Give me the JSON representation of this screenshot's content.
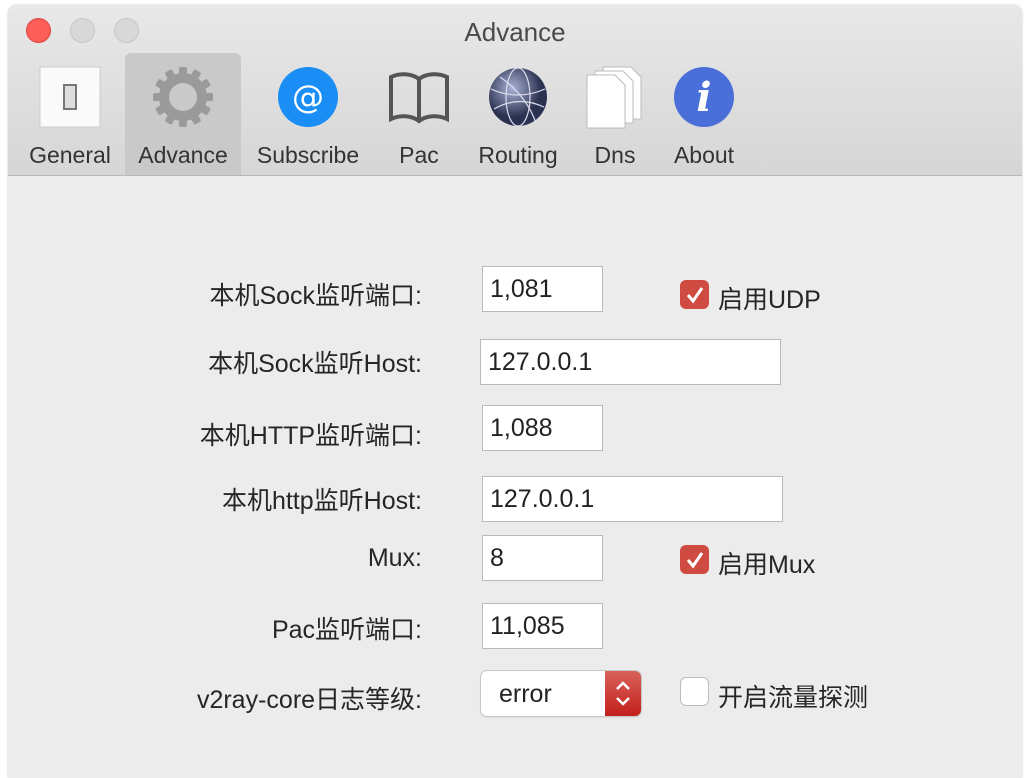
{
  "window": {
    "title": "Advance"
  },
  "toolbar": {
    "tabs": [
      {
        "label": "General",
        "icon": "switch-icon"
      },
      {
        "label": "Advance",
        "icon": "gear-icon",
        "selected": true
      },
      {
        "label": "Subscribe",
        "icon": "at-sign-icon"
      },
      {
        "label": "Pac",
        "icon": "book-icon"
      },
      {
        "label": "Routing",
        "icon": "globe-icon"
      },
      {
        "label": "Dns",
        "icon": "documents-icon"
      },
      {
        "label": "About",
        "icon": "info-icon"
      }
    ]
  },
  "form": {
    "sock_port": {
      "label": "本机Sock监听端口:",
      "value": "1,081"
    },
    "enable_udp": {
      "label": "启用UDP",
      "checked": true
    },
    "sock_host": {
      "label": "本机Sock监听Host:",
      "value": "127.0.0.1"
    },
    "http_port": {
      "label": "本机HTTP监听端口:",
      "value": "1,088"
    },
    "http_host": {
      "label": "本机http监听Host:",
      "value": "127.0.0.1"
    },
    "mux": {
      "label": "Mux:",
      "value": "8"
    },
    "enable_mux": {
      "label": "启用Mux",
      "checked": true
    },
    "pac_port": {
      "label": "Pac监听端口:",
      "value": "11,085"
    },
    "log_level": {
      "label": "v2ray-core日志等级:",
      "value": "error"
    },
    "traffic_detect": {
      "label": "开启流量探测",
      "checked": false
    }
  },
  "colors": {
    "accent": "#cf4a40",
    "close": "#fc5f57"
  }
}
